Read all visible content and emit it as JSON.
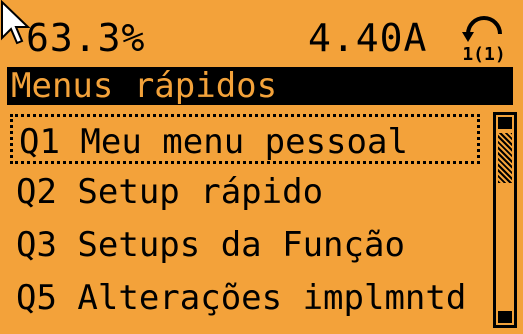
{
  "status": {
    "value_percent": "63.3%",
    "value_current": "4.40A",
    "setup_indicator": "1(1)"
  },
  "title": "Menus rápidos",
  "menu": {
    "items": [
      {
        "label": "Q1 Meu menu pessoal",
        "selected": true
      },
      {
        "label": "Q2 Setup rápido",
        "selected": false
      },
      {
        "label": "Q3 Setups da Função",
        "selected": false
      },
      {
        "label": "Q5 Alterações implmntd",
        "selected": false
      }
    ]
  },
  "scrollbar": {
    "position_fraction": 0.0
  },
  "colors": {
    "lcd_background": "#f3a23a",
    "ink": "#000000"
  }
}
